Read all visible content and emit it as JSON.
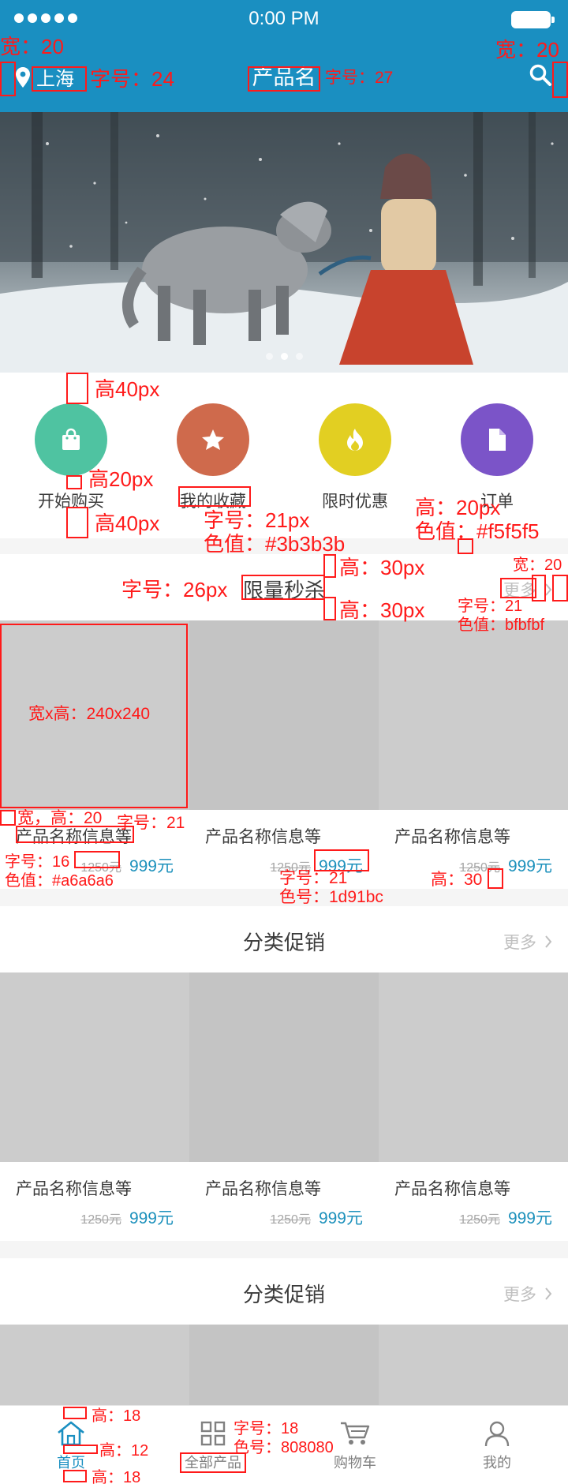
{
  "status_bar": {
    "time": "0:00 PM"
  },
  "header": {
    "location": "上海",
    "title": "产品名"
  },
  "banner": {
    "dots": 3,
    "active_dot": 1
  },
  "quick_nav": [
    {
      "label": "开始购买",
      "icon": "shopping-bag-icon",
      "color": "#4fc3a1"
    },
    {
      "label": "我的收藏",
      "icon": "star-icon",
      "color": "#cf6a4c"
    },
    {
      "label": "限时优惠",
      "icon": "flame-icon",
      "color": "#e2cf22"
    },
    {
      "label": "订单",
      "icon": "document-icon",
      "color": "#7b54c8"
    }
  ],
  "sections": [
    {
      "title": "限量秒杀",
      "more": "更多",
      "products": [
        {
          "name": "产品名称信息等",
          "old_price": "1250元",
          "price": "999元"
        },
        {
          "name": "产品名称信息等",
          "old_price": "1250元",
          "price": "999元"
        },
        {
          "name": "产品名称信息等",
          "old_price": "1250元",
          "price": "999元"
        }
      ]
    },
    {
      "title": "分类促销",
      "more": "更多",
      "products": [
        {
          "name": "产品名称信息等",
          "old_price": "1250元",
          "price": "999元"
        },
        {
          "name": "产品名称信息等",
          "old_price": "1250元",
          "price": "999元"
        },
        {
          "name": "产品名称信息等",
          "old_price": "1250元",
          "price": "999元"
        }
      ]
    },
    {
      "title": "分类促销",
      "more": "更多"
    }
  ],
  "tab_bar": [
    {
      "label": "首页",
      "icon": "home-icon",
      "active": true
    },
    {
      "label": "全部产品",
      "icon": "grid-icon",
      "active": false
    },
    {
      "label": "购物车",
      "icon": "cart-icon",
      "active": false
    },
    {
      "label": "我的",
      "icon": "user-icon",
      "active": false
    }
  ],
  "annotations": {
    "a1": "宽：20",
    "a2": "宽：20",
    "a3": "字号：24",
    "a4": "字号：27",
    "a5": "高40px",
    "a6": "高20px",
    "a7": "高40px",
    "a8": "字号：21px",
    "a9": "色值：#3b3b3b",
    "a10": "高：20px",
    "a11": "色值：#f5f5f5",
    "a12": "宽：20",
    "a13": "字号：26px",
    "a14": "高：30px",
    "a15": "高：30px",
    "a16": "字号：21",
    "a17": "色值：bfbfbf",
    "a18": "宽x高：240x240",
    "a19": "宽，高：20",
    "a20": "字号：21",
    "a21": "字号：16",
    "a22": "色值：#a6a6a6",
    "a23": "字号：21",
    "a24": "色号：1d91bc",
    "a25": "高：30",
    "a26": "高：18",
    "a27": "高：12",
    "a28": "高：18",
    "a29": "字号：18",
    "a30": "色号：808080"
  }
}
